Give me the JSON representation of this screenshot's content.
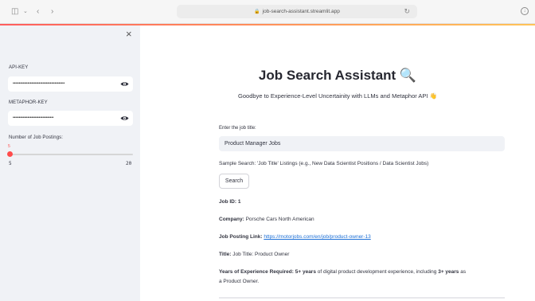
{
  "browser": {
    "url": "job-search-assistant.streamlit.app"
  },
  "sidebar": {
    "api_key_label": "API-KEY",
    "api_key_value": "••••••••••••••••••••••••••••••••••••••••••",
    "metaphor_key_label": "METAPHOR-KEY",
    "metaphor_key_value": "•••••••••••••••••••••••••••••••••",
    "slider": {
      "label": "Number of Job Postings:",
      "value": "5",
      "min": "5",
      "max": "20"
    }
  },
  "main": {
    "title": "Job Search Assistant 🔍",
    "subtitle": "Goodbye to Experience-Level Uncertainity with LLMs and Metaphor API 👋",
    "input_label": "Enter the job title:",
    "input_value": "Product Manager Jobs",
    "sample_search": "Sample Search: 'Job Title' Listings (e.g., New Data Scientist Positions / Data Scientist Jobs)",
    "search_button": "Search",
    "result": {
      "job_id_label": "Job ID:",
      "job_id": "1",
      "company_label": "Company:",
      "company": "Porsche Cars North American",
      "link_label": "Job Posting Link:",
      "link": "https://motorjobs.com/en/job/product-owner-13",
      "title_label": "Title:",
      "title": "Job Title: Product Owner",
      "experience_label": "Years of Experience Required:",
      "experience_years": "5+ years",
      "experience_text_1": "of digital product development experience, including",
      "experience_years_2": "3+ years",
      "experience_text_2": "as",
      "experience_text_3": "a Product Owner."
    }
  },
  "colors": {
    "accent": "#ff4b4b",
    "sidebar_bg": "#f0f2f6",
    "link": "#1c6fd6"
  }
}
